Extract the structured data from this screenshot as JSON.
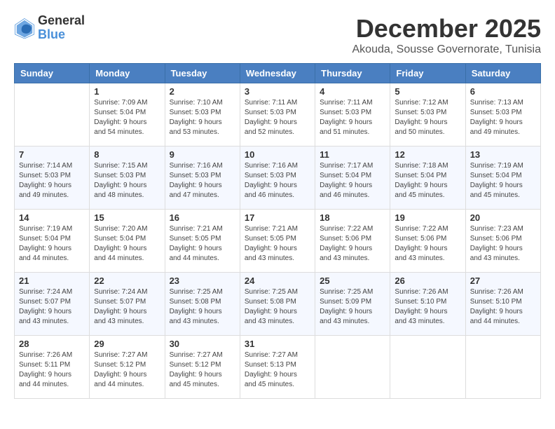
{
  "logo": {
    "general": "General",
    "blue": "Blue"
  },
  "header": {
    "month": "December 2025",
    "location": "Akouda, Sousse Governorate, Tunisia"
  },
  "weekdays": [
    "Sunday",
    "Monday",
    "Tuesday",
    "Wednesday",
    "Thursday",
    "Friday",
    "Saturday"
  ],
  "weeks": [
    [
      {
        "day": "",
        "sunrise": "",
        "sunset": "",
        "daylight": "",
        "empty": true
      },
      {
        "day": "1",
        "sunrise": "Sunrise: 7:09 AM",
        "sunset": "Sunset: 5:04 PM",
        "daylight": "Daylight: 9 hours and 54 minutes."
      },
      {
        "day": "2",
        "sunrise": "Sunrise: 7:10 AM",
        "sunset": "Sunset: 5:03 PM",
        "daylight": "Daylight: 9 hours and 53 minutes."
      },
      {
        "day": "3",
        "sunrise": "Sunrise: 7:11 AM",
        "sunset": "Sunset: 5:03 PM",
        "daylight": "Daylight: 9 hours and 52 minutes."
      },
      {
        "day": "4",
        "sunrise": "Sunrise: 7:11 AM",
        "sunset": "Sunset: 5:03 PM",
        "daylight": "Daylight: 9 hours and 51 minutes."
      },
      {
        "day": "5",
        "sunrise": "Sunrise: 7:12 AM",
        "sunset": "Sunset: 5:03 PM",
        "daylight": "Daylight: 9 hours and 50 minutes."
      },
      {
        "day": "6",
        "sunrise": "Sunrise: 7:13 AM",
        "sunset": "Sunset: 5:03 PM",
        "daylight": "Daylight: 9 hours and 49 minutes."
      }
    ],
    [
      {
        "day": "7",
        "sunrise": "Sunrise: 7:14 AM",
        "sunset": "Sunset: 5:03 PM",
        "daylight": "Daylight: 9 hours and 49 minutes."
      },
      {
        "day": "8",
        "sunrise": "Sunrise: 7:15 AM",
        "sunset": "Sunset: 5:03 PM",
        "daylight": "Daylight: 9 hours and 48 minutes."
      },
      {
        "day": "9",
        "sunrise": "Sunrise: 7:16 AM",
        "sunset": "Sunset: 5:03 PM",
        "daylight": "Daylight: 9 hours and 47 minutes."
      },
      {
        "day": "10",
        "sunrise": "Sunrise: 7:16 AM",
        "sunset": "Sunset: 5:03 PM",
        "daylight": "Daylight: 9 hours and 46 minutes."
      },
      {
        "day": "11",
        "sunrise": "Sunrise: 7:17 AM",
        "sunset": "Sunset: 5:04 PM",
        "daylight": "Daylight: 9 hours and 46 minutes."
      },
      {
        "day": "12",
        "sunrise": "Sunrise: 7:18 AM",
        "sunset": "Sunset: 5:04 PM",
        "daylight": "Daylight: 9 hours and 45 minutes."
      },
      {
        "day": "13",
        "sunrise": "Sunrise: 7:19 AM",
        "sunset": "Sunset: 5:04 PM",
        "daylight": "Daylight: 9 hours and 45 minutes."
      }
    ],
    [
      {
        "day": "14",
        "sunrise": "Sunrise: 7:19 AM",
        "sunset": "Sunset: 5:04 PM",
        "daylight": "Daylight: 9 hours and 44 minutes."
      },
      {
        "day": "15",
        "sunrise": "Sunrise: 7:20 AM",
        "sunset": "Sunset: 5:04 PM",
        "daylight": "Daylight: 9 hours and 44 minutes."
      },
      {
        "day": "16",
        "sunrise": "Sunrise: 7:21 AM",
        "sunset": "Sunset: 5:05 PM",
        "daylight": "Daylight: 9 hours and 44 minutes."
      },
      {
        "day": "17",
        "sunrise": "Sunrise: 7:21 AM",
        "sunset": "Sunset: 5:05 PM",
        "daylight": "Daylight: 9 hours and 43 minutes."
      },
      {
        "day": "18",
        "sunrise": "Sunrise: 7:22 AM",
        "sunset": "Sunset: 5:06 PM",
        "daylight": "Daylight: 9 hours and 43 minutes."
      },
      {
        "day": "19",
        "sunrise": "Sunrise: 7:22 AM",
        "sunset": "Sunset: 5:06 PM",
        "daylight": "Daylight: 9 hours and 43 minutes."
      },
      {
        "day": "20",
        "sunrise": "Sunrise: 7:23 AM",
        "sunset": "Sunset: 5:06 PM",
        "daylight": "Daylight: 9 hours and 43 minutes."
      }
    ],
    [
      {
        "day": "21",
        "sunrise": "Sunrise: 7:24 AM",
        "sunset": "Sunset: 5:07 PM",
        "daylight": "Daylight: 9 hours and 43 minutes."
      },
      {
        "day": "22",
        "sunrise": "Sunrise: 7:24 AM",
        "sunset": "Sunset: 5:07 PM",
        "daylight": "Daylight: 9 hours and 43 minutes."
      },
      {
        "day": "23",
        "sunrise": "Sunrise: 7:25 AM",
        "sunset": "Sunset: 5:08 PM",
        "daylight": "Daylight: 9 hours and 43 minutes."
      },
      {
        "day": "24",
        "sunrise": "Sunrise: 7:25 AM",
        "sunset": "Sunset: 5:08 PM",
        "daylight": "Daylight: 9 hours and 43 minutes."
      },
      {
        "day": "25",
        "sunrise": "Sunrise: 7:25 AM",
        "sunset": "Sunset: 5:09 PM",
        "daylight": "Daylight: 9 hours and 43 minutes."
      },
      {
        "day": "26",
        "sunrise": "Sunrise: 7:26 AM",
        "sunset": "Sunset: 5:10 PM",
        "daylight": "Daylight: 9 hours and 43 minutes."
      },
      {
        "day": "27",
        "sunrise": "Sunrise: 7:26 AM",
        "sunset": "Sunset: 5:10 PM",
        "daylight": "Daylight: 9 hours and 44 minutes."
      }
    ],
    [
      {
        "day": "28",
        "sunrise": "Sunrise: 7:26 AM",
        "sunset": "Sunset: 5:11 PM",
        "daylight": "Daylight: 9 hours and 44 minutes."
      },
      {
        "day": "29",
        "sunrise": "Sunrise: 7:27 AM",
        "sunset": "Sunset: 5:12 PM",
        "daylight": "Daylight: 9 hours and 44 minutes."
      },
      {
        "day": "30",
        "sunrise": "Sunrise: 7:27 AM",
        "sunset": "Sunset: 5:12 PM",
        "daylight": "Daylight: 9 hours and 45 minutes."
      },
      {
        "day": "31",
        "sunrise": "Sunrise: 7:27 AM",
        "sunset": "Sunset: 5:13 PM",
        "daylight": "Daylight: 9 hours and 45 minutes."
      },
      {
        "day": "",
        "sunrise": "",
        "sunset": "",
        "daylight": "",
        "empty": true
      },
      {
        "day": "",
        "sunrise": "",
        "sunset": "",
        "daylight": "",
        "empty": true
      },
      {
        "day": "",
        "sunrise": "",
        "sunset": "",
        "daylight": "",
        "empty": true
      }
    ]
  ]
}
